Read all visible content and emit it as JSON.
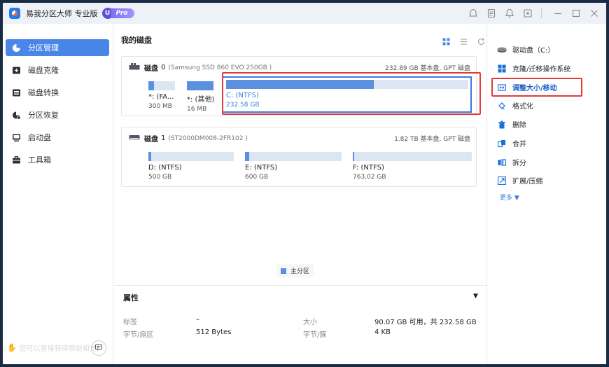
{
  "app": {
    "title": "易我分区大师 专业版",
    "badge_u": "U",
    "badge_pro": "Pro"
  },
  "sidebar": {
    "items": [
      {
        "label": "分区管理",
        "icon": "pie-chart-icon",
        "active": true
      },
      {
        "label": "磁盘克隆",
        "icon": "disk-clone-icon",
        "active": false
      },
      {
        "label": "磁盘转换",
        "icon": "disk-convert-icon",
        "active": false
      },
      {
        "label": "分区恢复",
        "icon": "partition-recovery-icon",
        "active": false
      },
      {
        "label": "启动盘",
        "icon": "bootable-disk-icon",
        "active": false
      },
      {
        "label": "工具箱",
        "icon": "toolbox-icon",
        "active": false
      }
    ],
    "promo_text": "您可以直接获得帮助和支持"
  },
  "main": {
    "title": "我的磁盘",
    "disks": [
      {
        "name": "磁盘",
        "number": "0",
        "model": "(Samsung SSD 860 EVO 250GB )",
        "info": "232.89 GB 基本盘, GPT 磁盘",
        "partitions": [
          {
            "label": "*: (FA...",
            "size": "300 MB",
            "used": 0.2
          },
          {
            "label": "*: (其他)",
            "size": "16 MB",
            "used": 1.0
          },
          {
            "label": "C: (NTFS)",
            "size": "232.58 GB",
            "used": 0.61,
            "selected": true
          }
        ]
      },
      {
        "name": "磁盘",
        "number": "1",
        "model": "(ST2000DM008-2FR102 )",
        "info": "1.82 TB 基本盘, GPT 磁盘",
        "partitions": [
          {
            "label": "D: (NTFS)",
            "size": "500 GB",
            "used": 0.02
          },
          {
            "label": "E: (NTFS)",
            "size": "600 GB",
            "used": 0.04
          },
          {
            "label": "F: (NTFS)",
            "size": "763.02 GB",
            "used": 0.01
          }
        ]
      }
    ],
    "legend": "主分区"
  },
  "properties": {
    "title": "属性",
    "label_key": "标签",
    "label_value": "–",
    "sector_key": "字节/扇区",
    "sector_value": "512 Bytes",
    "size_key": "大小",
    "size_value": "90.07 GB 可用，共 232.58 GB",
    "cluster_key": "字节/簇",
    "cluster_value": "4 KB"
  },
  "operations": {
    "items": [
      {
        "label": "驱动盘（C:）",
        "icon": "drive-icon"
      },
      {
        "label": "克隆/迁移操作系统",
        "icon": "windows-icon"
      },
      {
        "label": "调整大小/移动",
        "icon": "resize-icon",
        "highlight": true
      },
      {
        "label": "格式化",
        "icon": "format-icon"
      },
      {
        "label": "删除",
        "icon": "delete-icon"
      },
      {
        "label": "合并",
        "icon": "merge-icon"
      },
      {
        "label": "拆分",
        "icon": "split-icon"
      },
      {
        "label": "扩展/压缩",
        "icon": "extend-shrink-icon"
      }
    ],
    "more": "更多 ▼"
  },
  "colors": {
    "accent": "#4a86e8",
    "highlight_box": "#e23a3a",
    "partition_fill": "#5b8fe0",
    "partition_track": "#dce6f3"
  }
}
